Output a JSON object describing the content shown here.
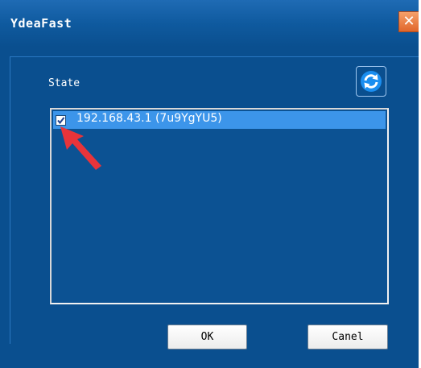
{
  "window": {
    "title": "YdeaFast",
    "close_icon": "close-icon"
  },
  "panel": {
    "state_label": "State",
    "refresh_icon": "refresh-icon"
  },
  "list": {
    "items": [
      {
        "label": "192.168.43.1 (7u9YgYU5)",
        "checked": true,
        "selected": true
      }
    ]
  },
  "buttons": {
    "ok_label": "OK",
    "cancel_label": "Canel"
  },
  "colors": {
    "background": "#0a4f8f",
    "selection": "#3c95ea",
    "annotation_arrow": "#e8343a",
    "close_button": "#e9783e"
  }
}
